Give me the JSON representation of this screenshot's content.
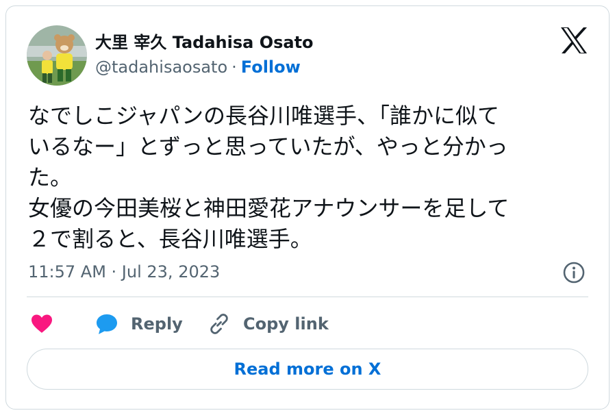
{
  "author": {
    "display_name": "大里 宰久 Tadahisa Osato",
    "handle": "@tadahisaosato",
    "separator": "·",
    "follow_label": "Follow",
    "avatar_icon": "avatar-photo"
  },
  "logo": {
    "icon": "x-logo-icon"
  },
  "tweet": {
    "lines": [
      "なでしこジャパンの長谷川唯選手、「誰かに似て",
      "いるなー」とずっと思っていたが、やっと分かっ",
      "た。",
      "女優の今田美桜と神田愛花アナウンサーを足して",
      "２で割ると、長谷川唯選手。"
    ],
    "timestamp": "11:57 AM · Jul 23, 2023"
  },
  "actions": {
    "like_icon": "heart-icon",
    "reply_label": "Reply",
    "reply_icon": "speech-bubble-icon",
    "copy_label": "Copy link",
    "copy_icon": "link-icon",
    "info_icon": "info-icon"
  },
  "footer": {
    "read_more_label": "Read more on X"
  },
  "colors": {
    "like": "#f91880",
    "reply": "#1d9bf0",
    "link": "#006fd6",
    "muted": "#536471",
    "border": "#cfd9de",
    "text": "#0f1419"
  }
}
